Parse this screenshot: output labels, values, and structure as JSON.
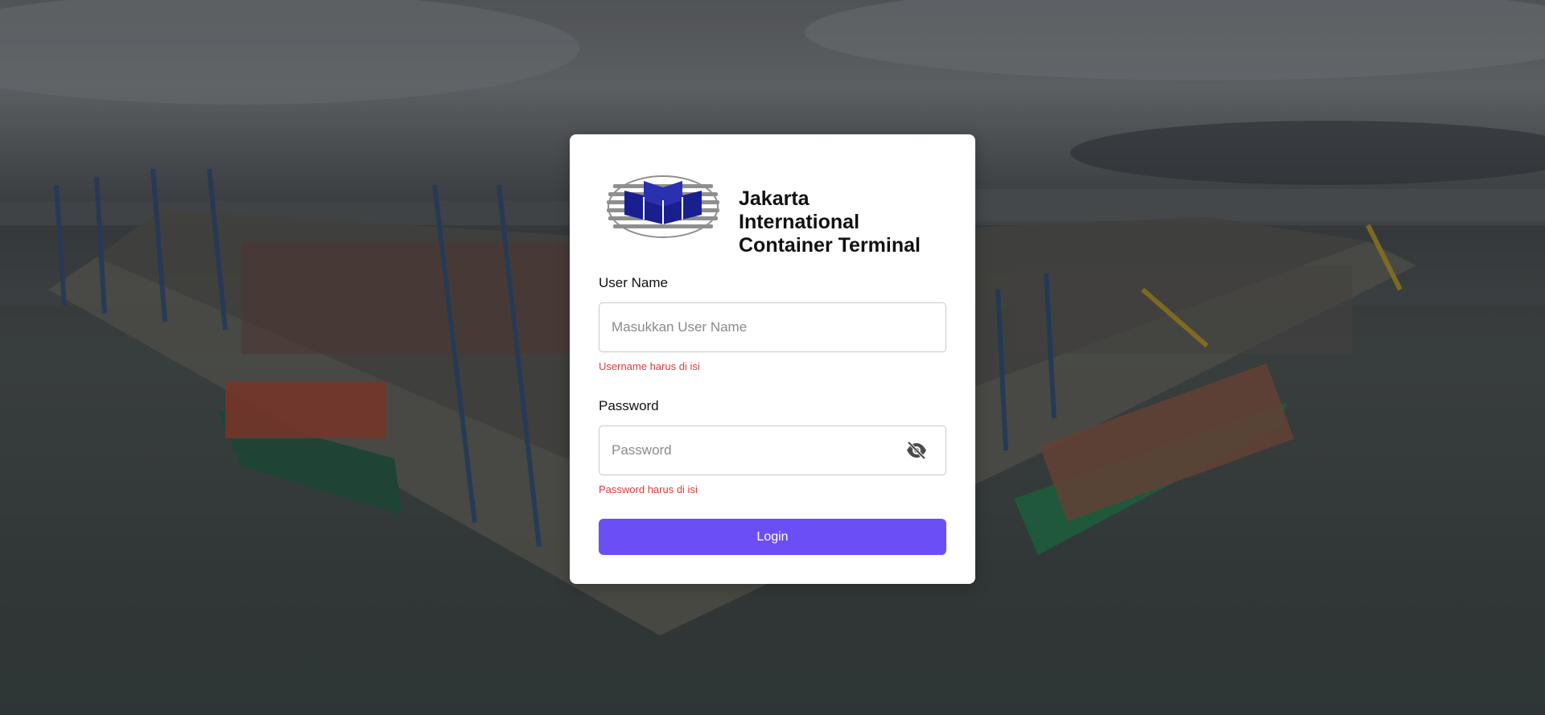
{
  "brand": {
    "name_line1": "Jakarta International",
    "name_line2": "Container Terminal",
    "logo_color": "#1a1f8f"
  },
  "form": {
    "username": {
      "label": "User Name",
      "placeholder": "Masukkan User Name",
      "value": "",
      "error": "Username harus di isi"
    },
    "password": {
      "label": "Password",
      "placeholder": "Password",
      "value": "",
      "error": "Password harus di isi",
      "toggle_icon": "eye-off-icon"
    },
    "login_label": "Login"
  },
  "colors": {
    "primary": "#6c4ef7",
    "error": "#e03a3a"
  }
}
